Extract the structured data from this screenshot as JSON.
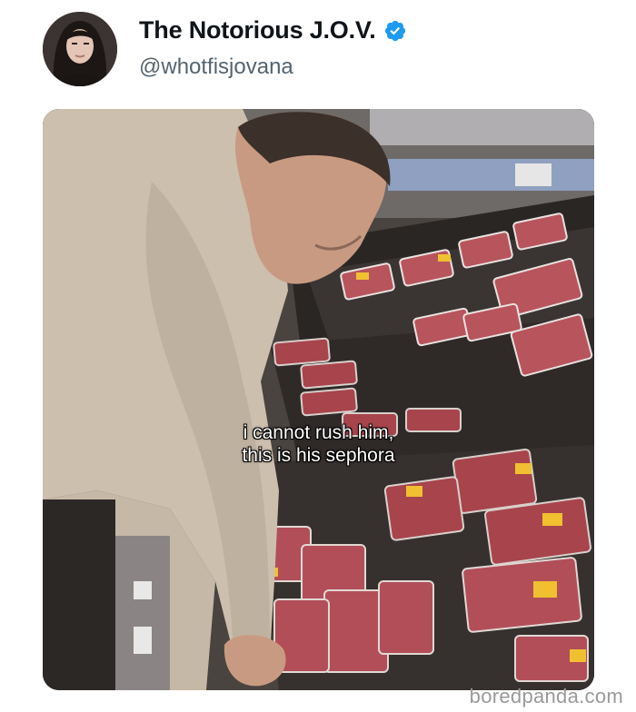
{
  "tweet": {
    "display_name": "The Notorious J.O.V.",
    "handle": "@whotfisjovana",
    "verified": true,
    "avatar_icon": "profile-photo",
    "verified_icon": "verified-badge-icon",
    "verified_color": "#1d9bf0"
  },
  "media": {
    "caption_line1": "i cannot rush him,",
    "caption_line2": "this is his sephora"
  },
  "watermark": {
    "text": "boredpanda.com"
  }
}
